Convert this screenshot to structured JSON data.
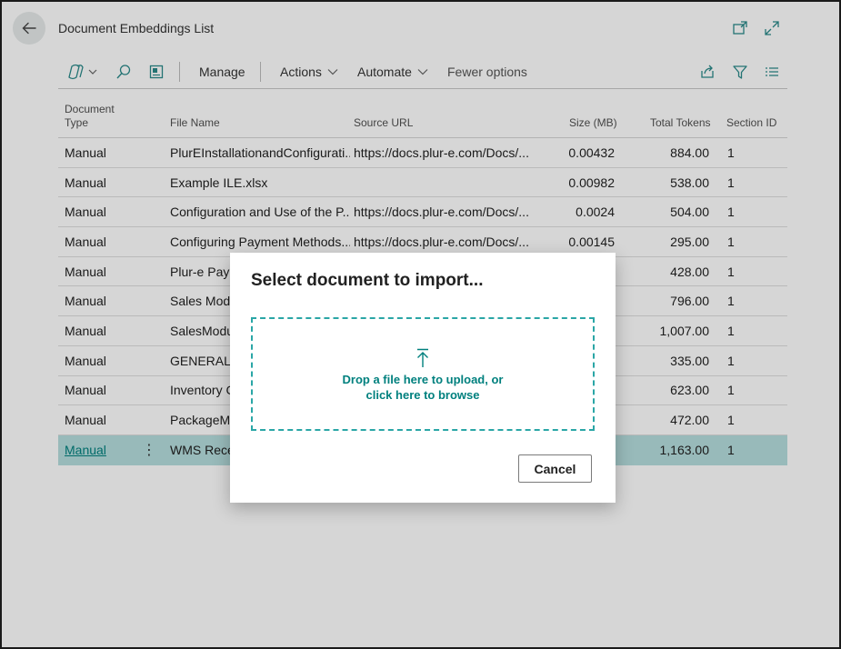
{
  "header": {
    "title": "Document Embeddings List",
    "icons": [
      "back-arrow-icon",
      "open-new-window-icon",
      "expand-icon"
    ]
  },
  "actionbar": {
    "manage_label": "Manage",
    "actions_label": "Actions",
    "automate_label": "Automate",
    "fewer_options_label": "Fewer options",
    "icons": [
      "copilot-icon",
      "search-icon",
      "edit-list-icon",
      "share-icon",
      "filter-icon",
      "list-view-icon"
    ]
  },
  "table": {
    "columns": {
      "type_line1": "Document",
      "type_line2": "Type",
      "file": "File Name",
      "url": "Source URL",
      "size": "Size (MB)",
      "tokens": "Total Tokens",
      "section": "Section ID"
    },
    "rows": [
      {
        "type": "Manual",
        "file": "PlurEInstallationandConfigurati...",
        "url": "https://docs.plur-e.com/Docs/...",
        "size": "0.00432",
        "tokens": "884.00",
        "section": "1"
      },
      {
        "type": "Manual",
        "file": "Example ILE.xlsx",
        "url": "",
        "size": "0.00982",
        "tokens": "538.00",
        "section": "1"
      },
      {
        "type": "Manual",
        "file": "Configuration and Use of the P...",
        "url": "https://docs.plur-e.com/Docs/...",
        "size": "0.0024",
        "tokens": "504.00",
        "section": "1"
      },
      {
        "type": "Manual",
        "file": "Configuring Payment Methods...",
        "url": "https://docs.plur-e.com/Docs/...",
        "size": "0.00145",
        "tokens": "295.00",
        "section": "1"
      },
      {
        "type": "Manual",
        "file": "Plur-e Payn",
        "url": "",
        "size": "",
        "tokens": "428.00",
        "section": "1"
      },
      {
        "type": "Manual",
        "file": "Sales Modu",
        "url": "",
        "size": "",
        "tokens": "796.00",
        "section": "1"
      },
      {
        "type": "Manual",
        "file": "SalesModu",
        "url": "",
        "size": "",
        "tokens": "1,007.00",
        "section": "1"
      },
      {
        "type": "Manual",
        "file": "GENERAL II",
        "url": "",
        "size": "",
        "tokens": "335.00",
        "section": "1"
      },
      {
        "type": "Manual",
        "file": "Inventory C",
        "url": "",
        "size": "",
        "tokens": "623.00",
        "section": "1"
      },
      {
        "type": "Manual",
        "file": "PackageMo",
        "url": "",
        "size": "",
        "tokens": "472.00",
        "section": "1"
      },
      {
        "type": "Manual",
        "file": "WMS Recei",
        "url": "",
        "size": "",
        "tokens": "1,163.00",
        "section": "1"
      }
    ],
    "selected_row_index": 10,
    "row_menu_glyph": "⋮"
  },
  "dialog": {
    "title": "Select document to import...",
    "drop_line1": "Drop a file here to upload, or",
    "drop_line2": "click here to browse",
    "cancel_label": "Cancel",
    "upload_icon": "upload-arrow-icon"
  },
  "colors": {
    "accent": "#00807e",
    "dropzone_border": "#2aa6a6",
    "selected_row": "#b6dede",
    "overlay": "rgba(0,0,0,0.16)"
  }
}
